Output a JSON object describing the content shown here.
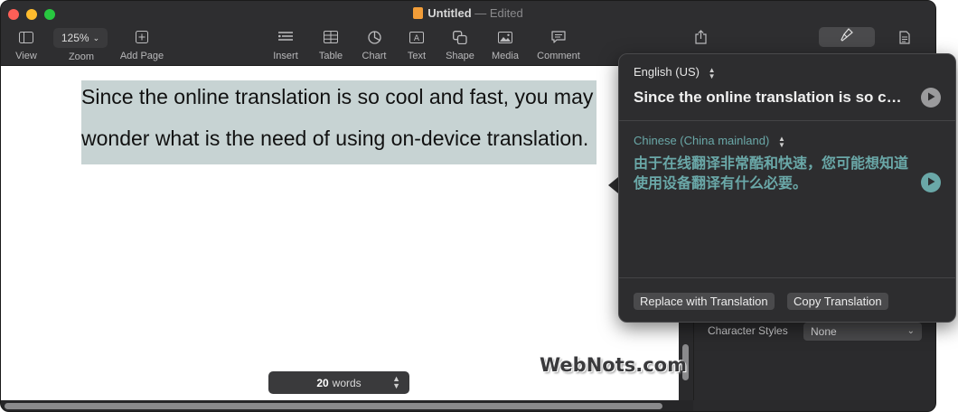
{
  "window": {
    "title": "Untitled",
    "status": "— Edited"
  },
  "toolbar": {
    "view_label": "View",
    "zoom_value": "125%",
    "zoom_label": "Zoom",
    "add_page_label": "Add Page",
    "insert_label": "Insert",
    "table_label": "Table",
    "chart_label": "Chart",
    "text_label": "Text",
    "shape_label": "Shape",
    "media_label": "Media",
    "comment_label": "Comment"
  },
  "document": {
    "line1": "Since the online translation is so cool and fast, you may",
    "line2": "wonder what is the need of using on-device translation."
  },
  "status_bar": {
    "word_count": "20",
    "word_unit": "words"
  },
  "sidebar": {
    "character_styles_label": "Character Styles",
    "character_styles_value": "None"
  },
  "translate_popover": {
    "source_language": "English (US)",
    "source_text": "Since the online translation is so cool and fast",
    "target_language": "Chinese (China mainland)",
    "target_text": "由于在线翻译非常酷和快速，您可能想知道使用设备翻译有什么必要。",
    "replace_button": "Replace with Translation",
    "copy_button": "Copy Translation"
  },
  "watermark": "WebNots.com",
  "colors": {
    "selection": "#c7d3d3",
    "translation_accent": "#6aa8a8",
    "toolbar_bg": "#2e2e30",
    "close": "#fe5f57",
    "minimize": "#febc2e",
    "zoom": "#28c840"
  }
}
